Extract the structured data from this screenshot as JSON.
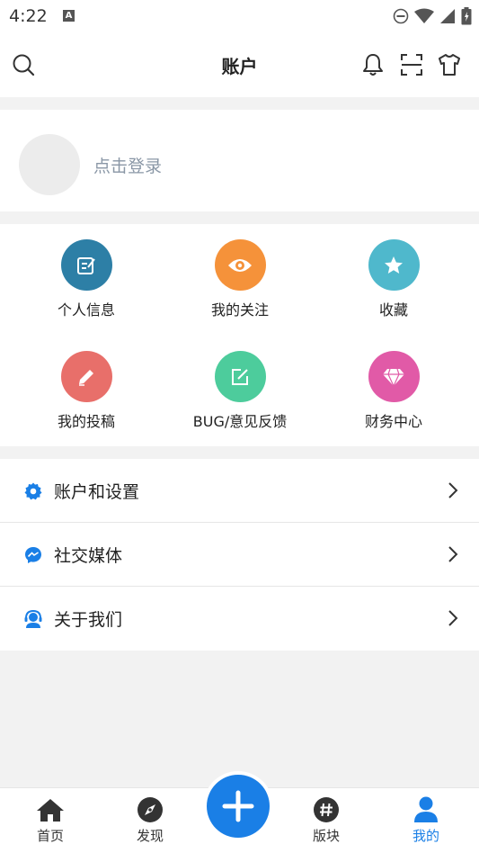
{
  "status_bar": {
    "time": "4:22",
    "notification_badge": "A"
  },
  "header": {
    "title": "账户"
  },
  "profile": {
    "login_prompt": "点击登录"
  },
  "grid": [
    {
      "label": "个人信息",
      "icon": "profile-edit-icon",
      "color": "#2d7fa6"
    },
    {
      "label": "我的关注",
      "icon": "eye-icon",
      "color": "#f5923a"
    },
    {
      "label": "收藏",
      "icon": "star-icon",
      "color": "#4fb8cc"
    },
    {
      "label": "我的投稿",
      "icon": "pencil-icon",
      "color": "#e86f6a"
    },
    {
      "label": "BUG/意见反馈",
      "icon": "feedback-icon",
      "color": "#4dcc9c"
    },
    {
      "label": "财务中心",
      "icon": "diamond-icon",
      "color": "#e15aa7"
    }
  ],
  "settings_list": [
    {
      "label": "账户和设置",
      "icon": "gear-icon"
    },
    {
      "label": "社交媒体",
      "icon": "messenger-icon"
    },
    {
      "label": "关于我们",
      "icon": "support-icon"
    }
  ],
  "bottom_nav": [
    {
      "label": "首页",
      "icon": "home-icon"
    },
    {
      "label": "发现",
      "icon": "compass-icon"
    },
    {
      "label": "版块",
      "icon": "hashtag-icon"
    },
    {
      "label": "我的",
      "icon": "user-icon",
      "active": true
    }
  ],
  "colors": {
    "accent": "#1a7fe6",
    "login_text": "#8a97a6"
  }
}
